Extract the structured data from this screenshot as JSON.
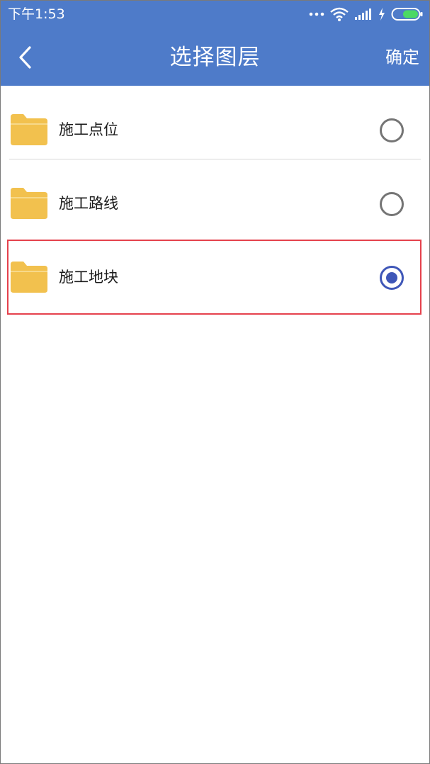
{
  "status_bar": {
    "time": "下午1:53",
    "icons": [
      "more-dots-icon",
      "wifi-icon",
      "signal-icon",
      "charging-icon",
      "battery-icon"
    ]
  },
  "app_bar": {
    "back_icon": "chevron-left-icon",
    "title": "选择图层",
    "confirm_label": "确定",
    "color": "#4e7bc9"
  },
  "layers": [
    {
      "label": "施工点位",
      "selected": false,
      "icon": "folder-icon"
    },
    {
      "label": "施工路线",
      "selected": false,
      "icon": "folder-icon"
    },
    {
      "label": "施工地块",
      "selected": true,
      "icon": "folder-icon"
    }
  ],
  "colors": {
    "folder": "#f2c14e",
    "radio_checked": "#3f57b8",
    "radio_unchecked": "#757575",
    "highlight": "#e5424d"
  }
}
